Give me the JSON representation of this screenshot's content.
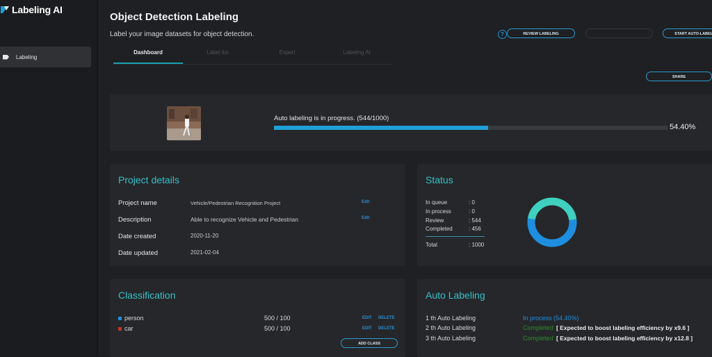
{
  "app": {
    "name": "Labeling AI"
  },
  "sidebar": {
    "items": [
      {
        "label": "Labeling",
        "icon": "tag-icon"
      }
    ]
  },
  "header": {
    "title": "Object Detection Labeling",
    "subtitle": "Label your image datasets for object detection.",
    "buttons": {
      "review": "REVIEW LABELING",
      "disabled": "",
      "start": "START AUTO-LABELING",
      "share": "SHARE"
    }
  },
  "tabs": [
    {
      "label": "Dashboard",
      "active": true
    },
    {
      "label": "Label list",
      "active": false
    },
    {
      "label": "Export",
      "active": false
    },
    {
      "label": "Labeling AI",
      "active": false
    }
  ],
  "progress": {
    "label": "Auto labeling is in progress. (544/1000)",
    "percent_text": "54.40%",
    "value": 0.544,
    "bar_color": "#1fa1d8"
  },
  "project_details": {
    "title": "Project details",
    "edit_label": "Edit",
    "rows": [
      {
        "label": "Project name",
        "value": "Vehicle/Pedestrian Recognition Project"
      },
      {
        "label": "Description",
        "value": "Able to recognize Vehicle and Pedestrian"
      },
      {
        "label": "Date created",
        "value": "2020-11-20"
      },
      {
        "label": "Date updated",
        "value": "2021-02-04"
      }
    ]
  },
  "status": {
    "title": "Status",
    "rows": [
      {
        "label": "In queue",
        "value": ": 0"
      },
      {
        "label": "In process",
        "value": ": 0"
      },
      {
        "label": "Review",
        "value": ": 544"
      },
      {
        "label": "Completed",
        "value": ": 456"
      }
    ],
    "total": {
      "label": "Total",
      "value": ": 1000"
    },
    "chart_data": {
      "type": "pie",
      "categories": [
        "In queue",
        "In process",
        "Review",
        "Completed"
      ],
      "values": [
        0,
        0,
        544,
        456
      ],
      "colors": [
        "#2a2b2e",
        "#2a2b2e",
        "#1e8fe0",
        "#3fd0c0"
      ]
    }
  },
  "classification": {
    "title": "Classification",
    "classes": [
      {
        "name": "person",
        "count": "500 / 100",
        "color": "#1e8fe0"
      },
      {
        "name": "car",
        "count": "500 / 100",
        "color": "#c0392b"
      }
    ],
    "edit_label": "EDIT",
    "delete_label": "DELETE",
    "add_label": "ADD CLASS"
  },
  "auto_labeling": {
    "title": "Auto Labeling",
    "rows": [
      {
        "label": "1 th Auto Labeling",
        "status": "In process  (54.40%)",
        "status_color": "#1e8fe0",
        "note": ""
      },
      {
        "label": "2 th Auto Labeling",
        "status": "Completed",
        "status_color": "#2f8a2f",
        "note": "[ Expected to boost labeling efficiency by x9.6 ]"
      },
      {
        "label": "3 th Auto Labeling",
        "status": "Completed",
        "status_color": "#2f8a2f",
        "note": "[ Expected to boost labeling efficiency by x12.8 ]"
      }
    ]
  }
}
